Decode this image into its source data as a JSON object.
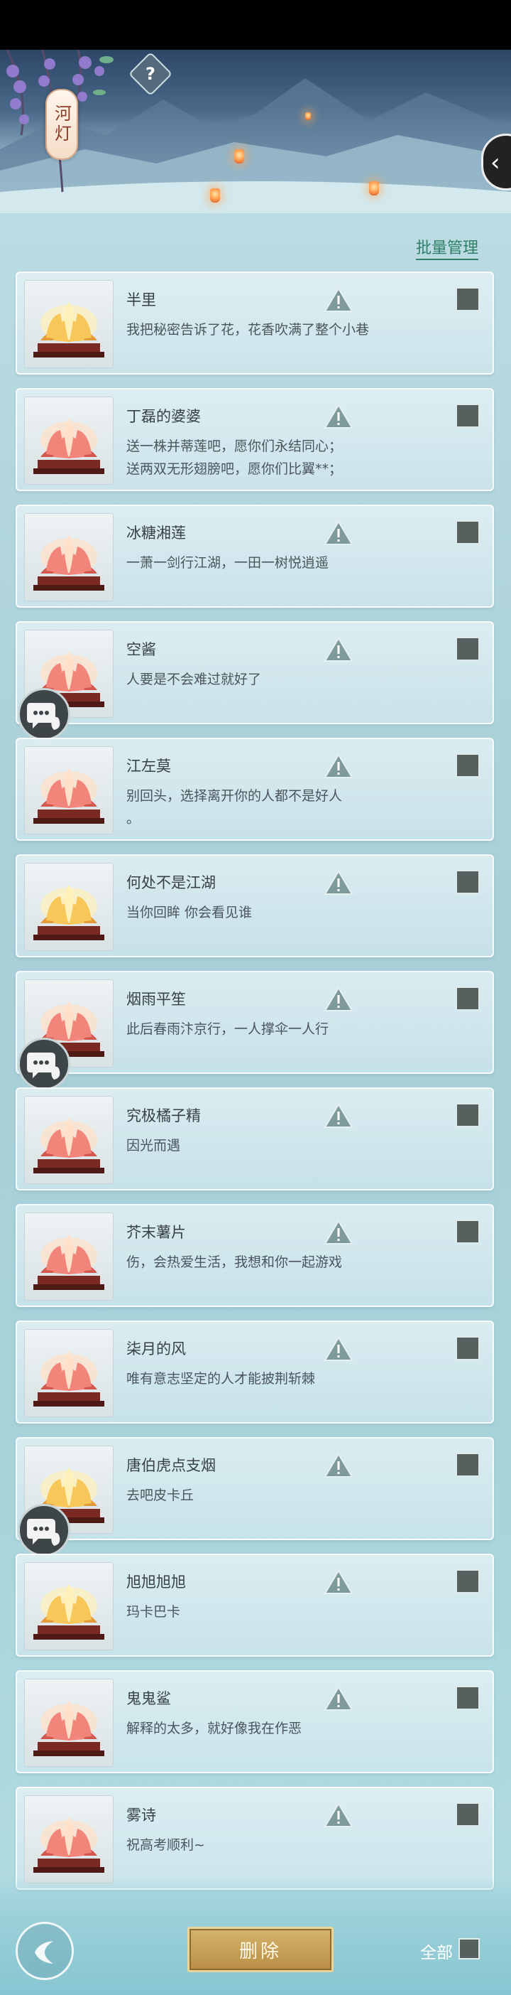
{
  "page": {
    "title": "河灯"
  },
  "header": {
    "help_label": "?",
    "side_back_icon": "chevron-left-icon",
    "batch_manage_label": "批量管理"
  },
  "colors": {
    "accent": "#2e7f66",
    "checkbox": "#56605f",
    "delete_button": "#c9a45a"
  },
  "lanterns": [
    {
      "name": "半里",
      "message": "我把秘密告诉了花，花香吹满了整个小巷",
      "lotus": "gold",
      "has_chat_badge": false
    },
    {
      "name": "丁磊的婆婆",
      "message": "送一株并蒂莲吧，愿你们永结同心；\n送两双无形翅膀吧，愿你们比翼**；",
      "lotus": "pink",
      "has_chat_badge": false
    },
    {
      "name": "冰糖湘莲",
      "message": "一萧一剑行江湖，一田一树悦逍遥",
      "lotus": "pink",
      "has_chat_badge": false
    },
    {
      "name": "空酱",
      "message": "人要是不会难过就好了",
      "lotus": "pink",
      "has_chat_badge": true
    },
    {
      "name": "江左莫",
      "message": "别回头，选择离开你的人都不是好人\n。",
      "lotus": "pink",
      "has_chat_badge": false
    },
    {
      "name": "何处不是江湖",
      "message": "当你回眸  你会看见谁",
      "lotus": "gold",
      "has_chat_badge": false
    },
    {
      "name": "烟雨平笙",
      "message": "此后春雨汴京行，一人撑伞一人行",
      "lotus": "pink",
      "has_chat_badge": true
    },
    {
      "name": "究极橘子精",
      "message": "因光而遇",
      "lotus": "pink",
      "has_chat_badge": false
    },
    {
      "name": "芥末薯片",
      "message": "伤，会热爱生活，我想和你一起游戏",
      "lotus": "pink",
      "has_chat_badge": false
    },
    {
      "name": "柒月的风",
      "message": "唯有意志坚定的人才能披荆斩棘",
      "lotus": "pink",
      "has_chat_badge": false
    },
    {
      "name": "唐伯虎点支烟",
      "message": "去吧皮卡丘",
      "lotus": "gold",
      "has_chat_badge": true
    },
    {
      "name": "旭旭旭旭",
      "message": "玛卡巴卡",
      "lotus": "gold",
      "has_chat_badge": false
    },
    {
      "name": "鬼鬼鲨",
      "message": "解释的太多，就好像我在作恶",
      "lotus": "pink",
      "has_chat_badge": false
    },
    {
      "name": "雾诗",
      "message": "祝高考顺利~",
      "lotus": "pink",
      "has_chat_badge": false
    }
  ],
  "footer": {
    "back_icon": "back-arrow-icon",
    "delete_label": "删除",
    "select_all_label": "全部"
  }
}
